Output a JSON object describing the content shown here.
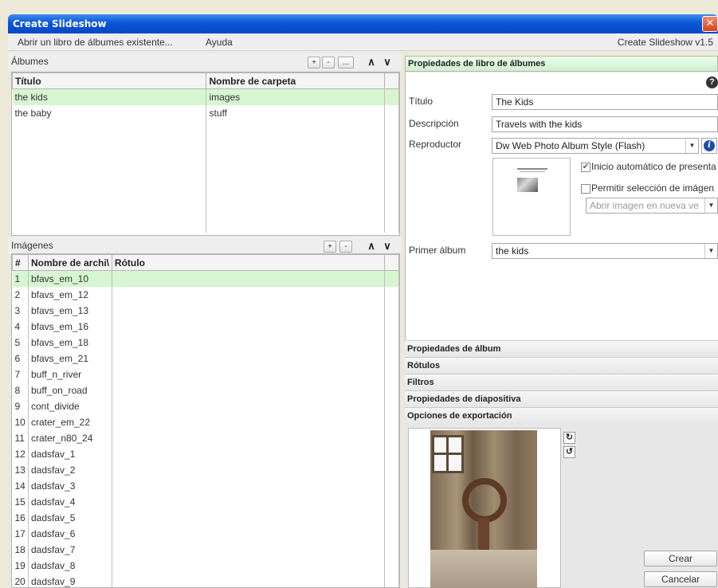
{
  "window": {
    "title": "Create Slideshow",
    "close_icon": "close-icon"
  },
  "menu": {
    "open_book": "Abrir un libro de álbumes existente...",
    "help": "Ayuda",
    "version": "Create Slideshow v1.5"
  },
  "albums": {
    "header": "Álbumes",
    "buttons": {
      "add": "+",
      "remove": "-",
      "more": "...",
      "up": "∧",
      "down": "∨"
    },
    "columns": [
      "Título",
      "Nombre de carpeta"
    ],
    "rows": [
      {
        "title": "the kids",
        "folder": "images",
        "selected": true
      },
      {
        "title": "the baby",
        "folder": "stuff",
        "selected": false
      }
    ]
  },
  "images": {
    "header": "Imágenes",
    "buttons": {
      "add": "+",
      "remove": "-",
      "up": "∧",
      "down": "∨"
    },
    "columns": [
      "#",
      "Nombre de archi\\",
      "Rótulo"
    ],
    "rows": [
      {
        "n": "1",
        "name": "bfavs_em_10",
        "caption": "",
        "selected": true
      },
      {
        "n": "2",
        "name": "bfavs_em_12",
        "caption": ""
      },
      {
        "n": "3",
        "name": "bfavs_em_13",
        "caption": ""
      },
      {
        "n": "4",
        "name": "bfavs_em_16",
        "caption": ""
      },
      {
        "n": "5",
        "name": "bfavs_em_18",
        "caption": ""
      },
      {
        "n": "6",
        "name": "bfavs_em_21",
        "caption": ""
      },
      {
        "n": "7",
        "name": "buff_n_river",
        "caption": ""
      },
      {
        "n": "8",
        "name": "buff_on_road",
        "caption": ""
      },
      {
        "n": "9",
        "name": "cont_divide",
        "caption": ""
      },
      {
        "n": "10",
        "name": "crater_em_22",
        "caption": ""
      },
      {
        "n": "11",
        "name": "crater_n80_24",
        "caption": ""
      },
      {
        "n": "12",
        "name": "dadsfav_1",
        "caption": ""
      },
      {
        "n": "13",
        "name": "dadsfav_2",
        "caption": ""
      },
      {
        "n": "14",
        "name": "dadsfav_3",
        "caption": ""
      },
      {
        "n": "15",
        "name": "dadsfav_4",
        "caption": ""
      },
      {
        "n": "16",
        "name": "dadsfav_5",
        "caption": ""
      },
      {
        "n": "17",
        "name": "dadsfav_6",
        "caption": ""
      },
      {
        "n": "18",
        "name": "dadsfav_7",
        "caption": ""
      },
      {
        "n": "19",
        "name": "dadsfav_8",
        "caption": ""
      },
      {
        "n": "20",
        "name": "dadsfav_9",
        "caption": ""
      }
    ]
  },
  "book_props": {
    "header": "Propiedades de libro de álbumes",
    "help_icon": "?",
    "title_label": "Título",
    "title_value": "The Kids",
    "desc_label": "Descripción",
    "desc_value": "Travels with the kids",
    "player_label": "Reproductor",
    "player_value": "Dw Web Photo Album Style (Flash)",
    "autostart_label": "Inicio automático de presenta",
    "autostart_checked": true,
    "allow_select_label": "Permitir selección de imágen",
    "allow_select_checked": false,
    "open_image_value": "Abrir imagen en nueva ve",
    "first_album_label": "Primer álbum",
    "first_album_value": "the kids"
  },
  "accordion": [
    "Propiedades de álbum",
    "Rótulos",
    "Filtros",
    "Propiedades de diapositiva",
    "Opciones de exportación"
  ],
  "preview": {
    "rotate_cw_icon": "rotate-cw-icon",
    "rotate_ccw_icon": "rotate-ccw-icon"
  },
  "actions": {
    "create": "Crear",
    "cancel": "Cancelar"
  },
  "colors": {
    "selection": "#d6f5d0",
    "titlebar": "#0a58d6",
    "section_header": "#cfeecf"
  }
}
